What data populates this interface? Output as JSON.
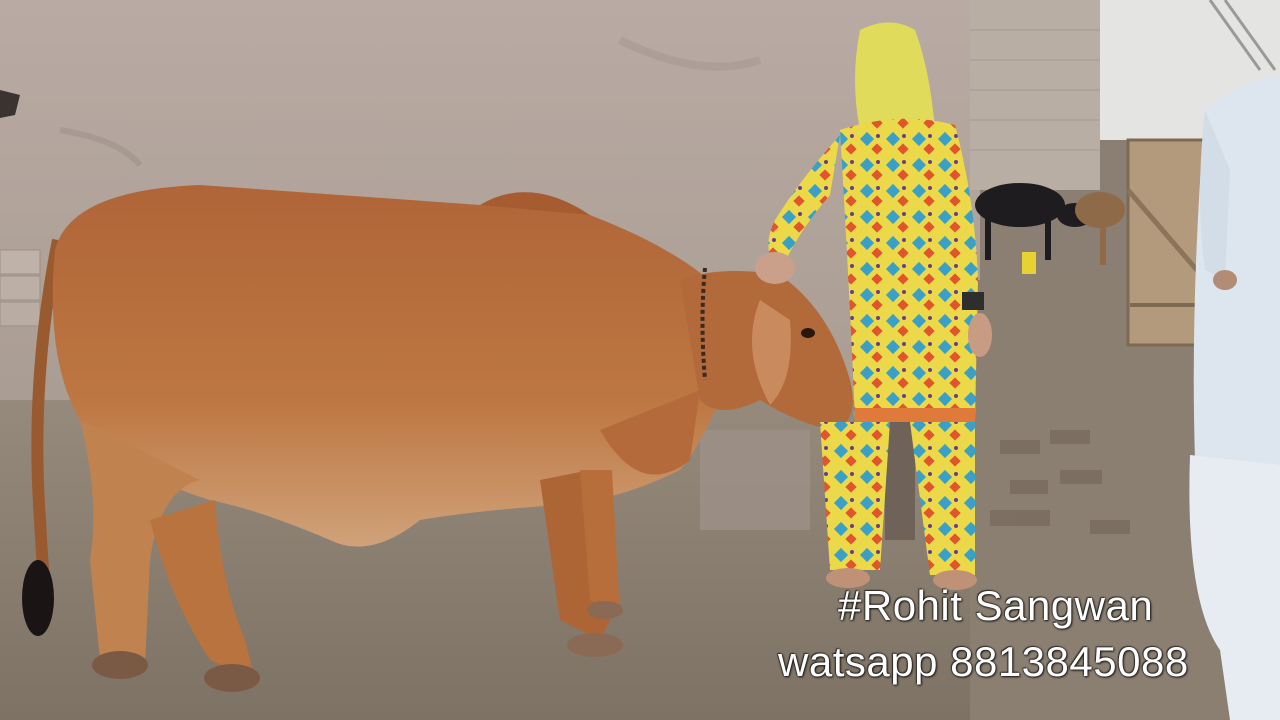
{
  "overlay": {
    "line1": "#Rohit Sangwan",
    "line2": "watsapp 8813845088"
  },
  "colors": {
    "wall": "#b7aaa0",
    "ground": "#8a7f70",
    "cow": "#b56b3c",
    "dress": "#e8d84a",
    "caption_text": "#ffffff"
  }
}
